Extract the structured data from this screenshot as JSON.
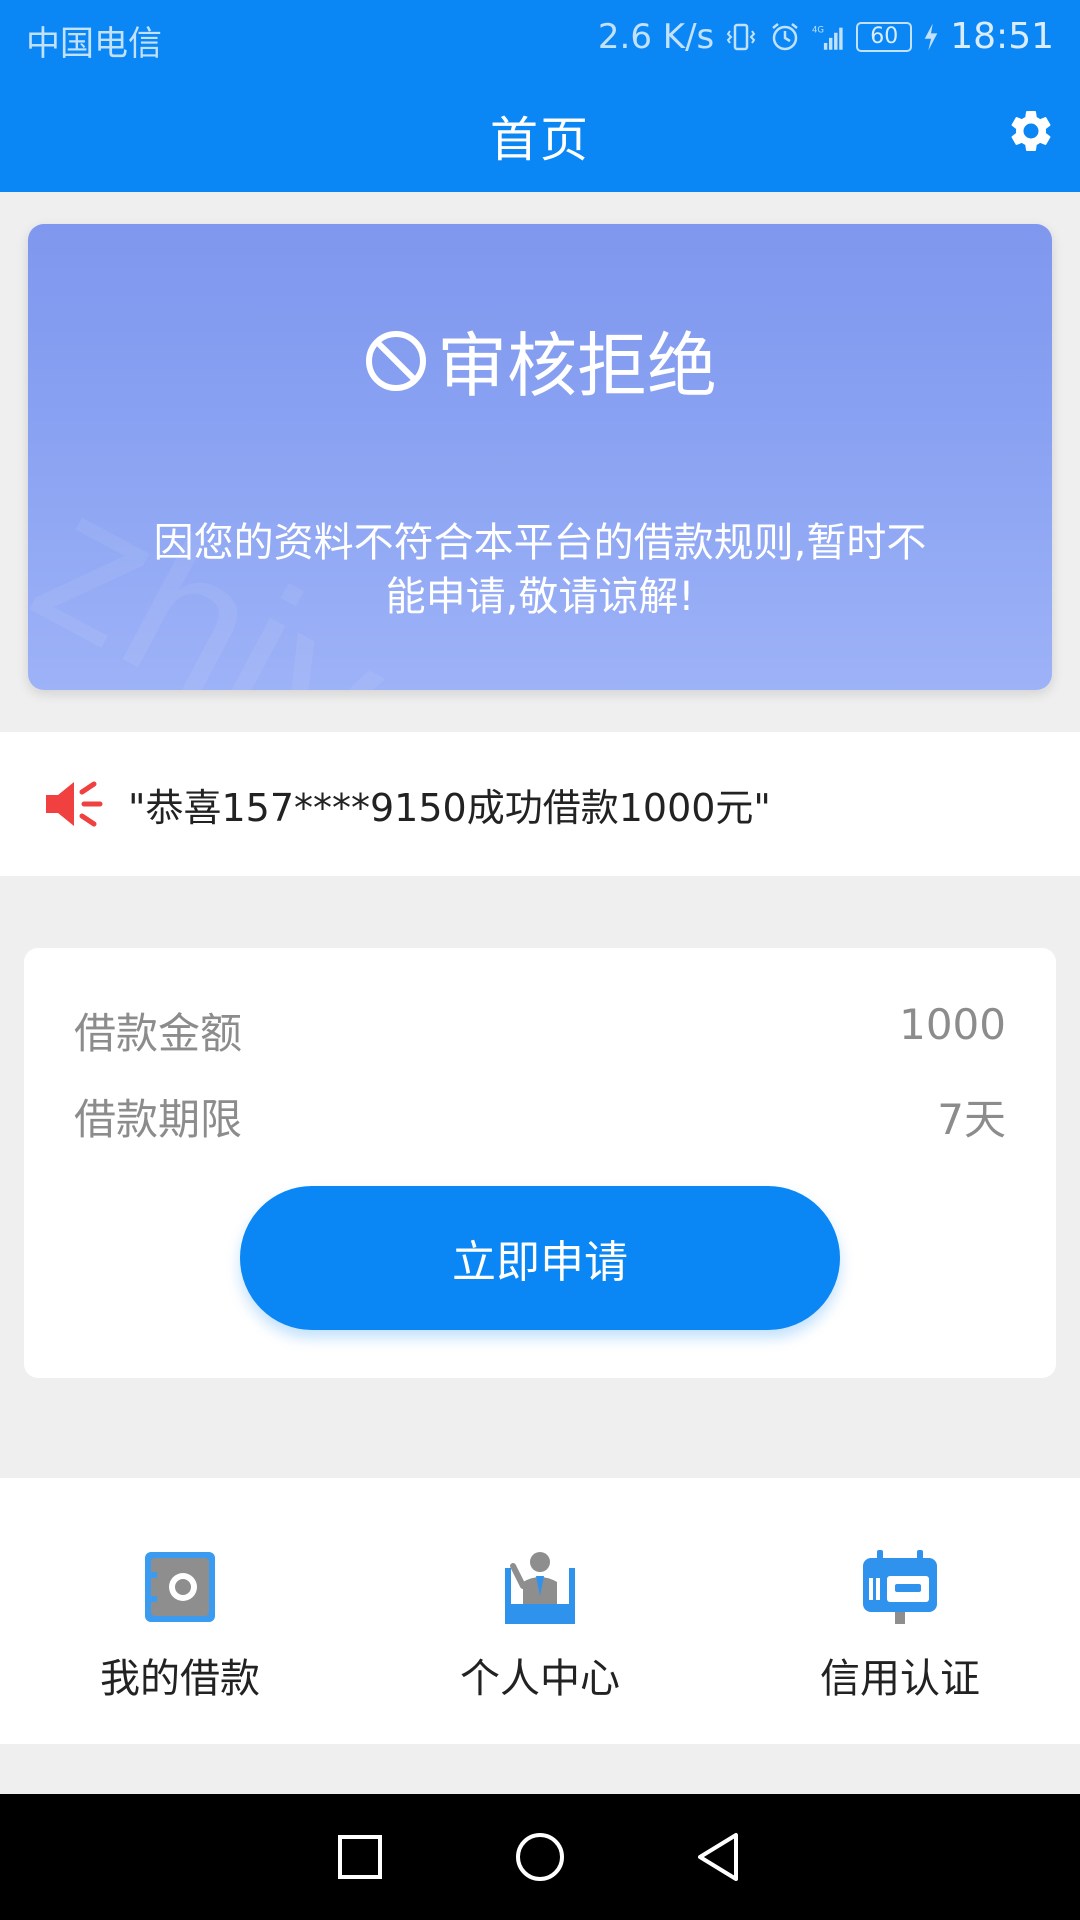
{
  "status_bar": {
    "carrier": "中国电信",
    "speed": "2.6 K/s",
    "battery": "60",
    "time": "18:51"
  },
  "header": {
    "title": "首页"
  },
  "banner": {
    "watermark": "zhiyong",
    "title": "审核拒绝",
    "message": "因您的资料不符合本平台的借款规则,暂时不能申请,敬请谅解!"
  },
  "notice": {
    "text": "\"恭喜157****9150成功借款1000元\""
  },
  "loan": {
    "amount_label": "借款金额",
    "amount_value": "1000",
    "term_label": "借款期限",
    "term_value": "7天",
    "apply_label": "立即申请"
  },
  "shortcuts": [
    {
      "label": "我的借款",
      "icon": "safe-icon"
    },
    {
      "label": "个人中心",
      "icon": "person-icon"
    },
    {
      "label": "信用认证",
      "icon": "credit-card-icon"
    }
  ],
  "colors": {
    "primary": "#0a86f5",
    "banner_start": "#7f97ee",
    "banner_end": "#9db2f7",
    "speaker": "#f04040"
  }
}
